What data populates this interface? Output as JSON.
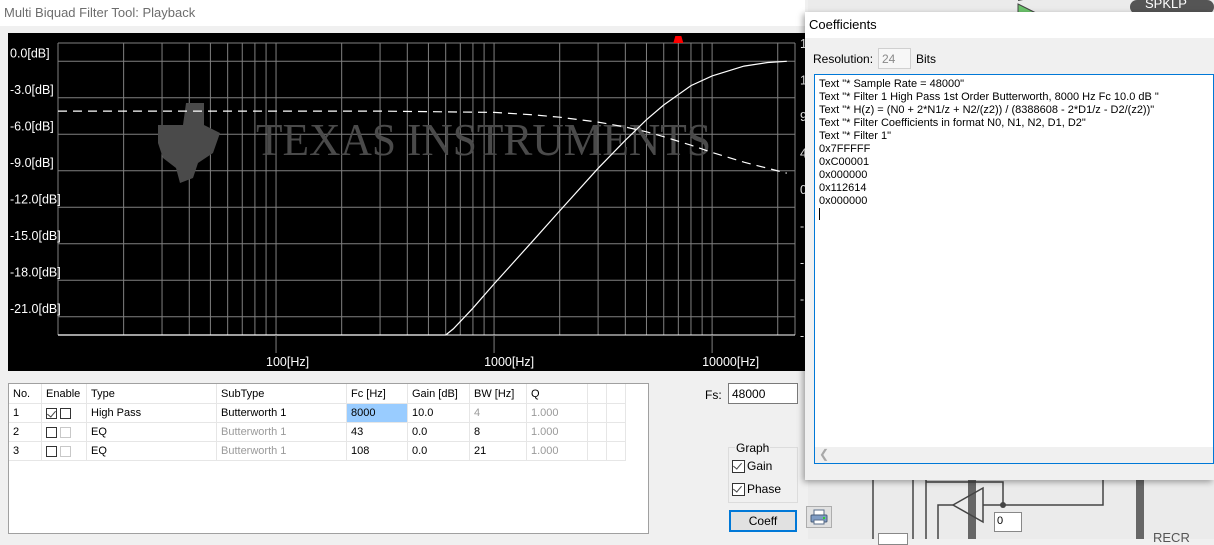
{
  "window": {
    "title": "Multi Biquad Filter Tool: Playback"
  },
  "chart_data": {
    "type": "line",
    "title": "",
    "xlabel": "",
    "ylabel": "",
    "x_scale": "log",
    "xlim": [
      10,
      24000
    ],
    "ylim": [
      -22.5,
      1.5
    ],
    "y_ticks": [
      {
        "value": 0,
        "label": "0.0[dB]"
      },
      {
        "value": -3,
        "label": "-3.0[dB]"
      },
      {
        "value": -6,
        "label": "-6.0[dB]"
      },
      {
        "value": -9,
        "label": "-9.0[dB]"
      },
      {
        "value": -12,
        "label": "-12.0[dB]"
      },
      {
        "value": -15,
        "label": "-15.0[dB]"
      },
      {
        "value": -18,
        "label": "-18.0[dB]"
      },
      {
        "value": -21,
        "label": "-21.0[dB]"
      }
    ],
    "x_ticks": [
      {
        "value": 100,
        "label": "100[Hz]"
      },
      {
        "value": 1000,
        "label": "1000[Hz]"
      },
      {
        "value": 10000,
        "label": "10000[Hz]"
      }
    ],
    "right_axis_ticks_partial": [
      "1",
      "1",
      "9",
      "4",
      "0",
      "-",
      "-",
      "-",
      "-"
    ],
    "grid": true,
    "watermark": "TEXAS INSTRUMENTS",
    "marker": {
      "x": 7000,
      "color": "#ff0000"
    },
    "series": [
      {
        "name": "Gain",
        "style": "solid",
        "color": "#ffffff",
        "x": [
          10,
          600,
          650,
          800,
          1000,
          1500,
          2000,
          3000,
          4000,
          5000,
          6000,
          8000,
          10000,
          14000,
          18000,
          22000
        ],
        "y": [
          -22.5,
          -22.5,
          -22.0,
          -20.3,
          -18.3,
          -14.8,
          -12.3,
          -8.8,
          -6.5,
          -4.8,
          -3.6,
          -2.0,
          -1.2,
          -0.4,
          -0.1,
          0.0
        ]
      },
      {
        "name": "Phase",
        "style": "dashed",
        "color": "#ffffff",
        "x": [
          10,
          100,
          300,
          1000,
          1500,
          2000,
          3000,
          4000,
          5000,
          6000,
          8000,
          10000,
          14000,
          18000,
          22000
        ],
        "y": [
          -4.1,
          -4.1,
          -4.1,
          -4.2,
          -4.4,
          -4.6,
          -5.0,
          -5.4,
          -5.8,
          -6.2,
          -6.9,
          -7.5,
          -8.3,
          -8.8,
          -9.2
        ]
      }
    ]
  },
  "table": {
    "headers": [
      "No.",
      "Enable",
      "Type",
      "SubType",
      "Fc [Hz]",
      "Gain [dB]",
      "BW [Hz]",
      "Q",
      "",
      ""
    ],
    "rows": [
      {
        "no": "1",
        "enable": true,
        "enable2": false,
        "enable2_disabled": false,
        "type": "High Pass",
        "subtype": "Butterworth 1",
        "subtype_grey": false,
        "fc": "8000",
        "fc_selected": true,
        "gain": "10.0",
        "bw": "4",
        "bw_grey": true,
        "q": "1.000"
      },
      {
        "no": "2",
        "enable": false,
        "enable2": false,
        "enable2_disabled": true,
        "type": "EQ",
        "subtype": "Butterworth 1",
        "subtype_grey": true,
        "fc": "43",
        "fc_selected": false,
        "gain": "0.0",
        "bw": "8",
        "bw_grey": false,
        "q": "1.000"
      },
      {
        "no": "3",
        "enable": false,
        "enable2": false,
        "enable2_disabled": true,
        "type": "EQ",
        "subtype": "Butterworth 1",
        "subtype_grey": true,
        "fc": "108",
        "fc_selected": false,
        "gain": "0.0",
        "bw": "21",
        "bw_grey": false,
        "q": "1.000"
      }
    ]
  },
  "controls": {
    "fs_label": "Fs:",
    "fs_value": "48000",
    "graph_group_label": "Graph",
    "gain_label": "Gain",
    "gain_checked": true,
    "phase_label": "Phase",
    "phase_checked": true,
    "coeff_button": "Coeff",
    "print_icon": "printer-icon"
  },
  "dialog": {
    "title": "Coefficients",
    "resolution_label": "Resolution:",
    "resolution_value": "24",
    "resolution_unit": "Bits",
    "lines": [
      "Text \"* Sample Rate = 48000\"",
      "Text \"* Filter 1 High Pass 1st Order Butterworth, 8000 Hz Fc 10.0 dB \"",
      "Text \"* H(z) = (N0 + 2*N1/z + N2/(z2)) / (8388608 - 2*D1/z - D2/(z2))\"",
      "Text \"* Filter Coefficients in format N0, N1, N2, D1, D2\"",
      "Text \"* Filter 1\"",
      "0x7FFFFF",
      "0xC00001",
      "0x000000",
      "0x112614",
      "0x000000"
    ]
  },
  "background": {
    "spklp_label": "SPKLP",
    "recr_label": "RECR",
    "block_value": "0"
  }
}
